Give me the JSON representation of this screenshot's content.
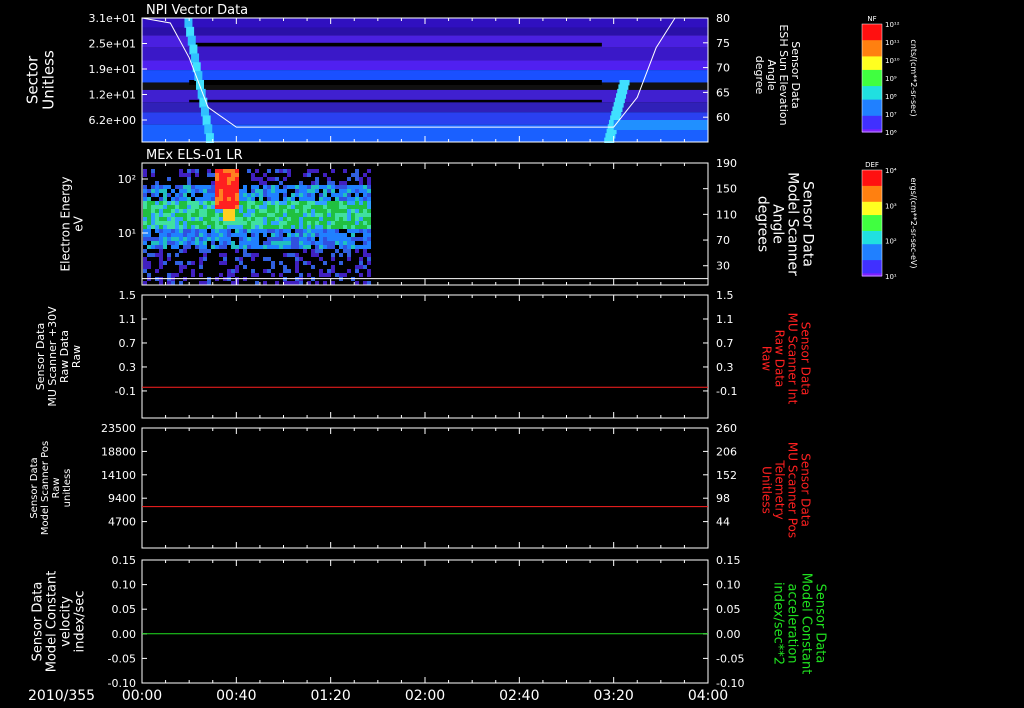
{
  "x_axis": {
    "date_label": "2010/355",
    "tick_labels": [
      "00:00",
      "00:40",
      "01:20",
      "02:00",
      "02:40",
      "03:20",
      "04:00"
    ],
    "tick_minutes": [
      0,
      40,
      80,
      120,
      160,
      200,
      240
    ],
    "range_minutes": [
      0,
      240
    ]
  },
  "chart_data": [
    {
      "type": "heatmap",
      "title": "NPI Vector Data",
      "ylabel": [
        "Sector",
        "Unitless"
      ],
      "y_tick_labels": [
        "3.1e+01",
        "2.5e+01",
        "1.9e+01",
        "1.2e+01",
        "6.2e+00"
      ],
      "y_tick_values": [
        31,
        25,
        19,
        12,
        6.2
      ],
      "y2label": [
        "Sensor Data",
        "ESH Sun Elevation",
        "Angle",
        "degree"
      ],
      "y2_tick_labels": [
        "80",
        "75",
        "70",
        "65",
        "60"
      ],
      "y2_range": [
        55,
        80
      ],
      "overlay_line": {
        "name": "ESH Sun Elevation Angle",
        "color": "#ffffff",
        "x_minutes": [
          0,
          12,
          20,
          28,
          40,
          80,
          120,
          160,
          200,
          210,
          218,
          226,
          240
        ],
        "y_degrees": [
          80,
          79,
          72,
          62,
          58,
          58,
          58,
          58,
          58,
          64,
          74,
          80,
          80
        ]
      },
      "colorbar": {
        "label": "NF",
        "units": "cnts/(cm**2-sr-sec)",
        "tick_labels": [
          "10¹²",
          "10¹¹",
          "10¹⁰",
          "10⁹",
          "10⁸",
          "10⁷",
          "10⁶"
        ],
        "scale": "log"
      }
    },
    {
      "type": "heatmap",
      "title": "MEx ELS-01 LR",
      "ylabel": [
        "Electron Energy",
        "eV"
      ],
      "y_tick_labels": [
        "10²",
        "10¹"
      ],
      "y_scale": "log",
      "data_extent_minutes": [
        0,
        96
      ],
      "y2label": [
        "Sensor Data",
        "Model Scanner",
        "Angle",
        "degrees"
      ],
      "y2_tick_labels": [
        "190",
        "150",
        "110",
        "70",
        "30"
      ],
      "y2_range": [
        0,
        190
      ],
      "overlay_line": {
        "name": "Model Scanner Angle",
        "color": "#ffffff",
        "x_minutes": [
          0,
          240
        ],
        "y_degrees": [
          10,
          10
        ]
      },
      "colorbar": {
        "label": "DEF",
        "units": "ergs/(cm**2-sr-sec-eV)",
        "tick_labels": [
          "10⁴",
          "10³",
          "10²",
          "10¹"
        ],
        "scale": "log"
      }
    },
    {
      "type": "line",
      "ylabel": [
        "Sensor Data",
        "MU Scanner +30V",
        "Raw Data",
        "Raw"
      ],
      "y_tick_labels": [
        "1.5",
        "1.1",
        "0.7",
        "0.3",
        "-0.1"
      ],
      "ylim": [
        -0.5,
        1.5
      ],
      "y2label": [
        "Sensor Data",
        "MU Scanner Int",
        "Raw Data",
        "Raw"
      ],
      "y2_tick_labels": [
        "1.5",
        "1.1",
        "0.7",
        "0.3",
        "-0.1"
      ],
      "series": [
        {
          "color": "#ff2020",
          "x_minutes": [
            0,
            240
          ],
          "y": [
            0.0,
            0.0
          ]
        }
      ]
    },
    {
      "type": "line",
      "ylabel": [
        "Sensor Data",
        "Model Scanner Pos",
        "Raw",
        "unitless"
      ],
      "y_tick_labels": [
        "23500",
        "18800",
        "14100",
        "9400",
        "4700"
      ],
      "ylim": [
        0,
        23500
      ],
      "y2label": [
        "Sensor Data",
        "MU Scanner Pos",
        "Telemetry",
        "Unitless"
      ],
      "y2_tick_labels": [
        "260",
        "206",
        "152",
        "98",
        "44"
      ],
      "series": [
        {
          "color": "#ff2020",
          "x_minutes": [
            0,
            240
          ],
          "y": [
            8100,
            8100
          ]
        }
      ]
    },
    {
      "type": "line",
      "ylabel": [
        "Sensor Data",
        "Model Constant",
        "velocity",
        "index/sec"
      ],
      "y_tick_labels": [
        "0.15",
        "0.10",
        "0.05",
        "0.00",
        "-0.05",
        "-0.10"
      ],
      "ylim": [
        -0.1,
        0.15
      ],
      "y2label": [
        "Sensor Data",
        "Model Constant",
        "acceleration",
        "index/sec**2"
      ],
      "y2_tick_labels": [
        "0.15",
        "0.10",
        "0.05",
        "0.00",
        "-0.05",
        "-0.10"
      ],
      "series": [
        {
          "color": "#20e020",
          "x_minutes": [
            0,
            240
          ],
          "y": [
            0.0,
            0.0
          ]
        }
      ]
    }
  ],
  "colors": {
    "background": "#000000",
    "axes": "#ffffff",
    "red_label": "#ff2020",
    "green_label": "#20e020"
  }
}
